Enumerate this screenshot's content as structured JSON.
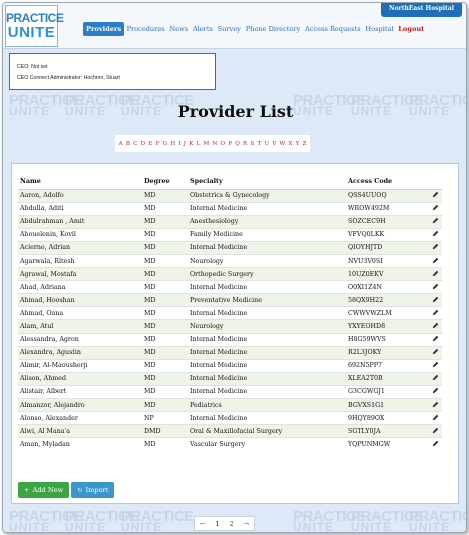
{
  "logo": {
    "line1": "PRACTICE",
    "line2": "UNITE"
  },
  "org_badge": "NorthEast Hospital",
  "nav": {
    "items": [
      "Providers",
      "Procedures",
      "News",
      "Alerts",
      "Survey",
      "Phone Directory",
      "Access Requests",
      "Hospital"
    ],
    "logout": "Logout",
    "active": "Providers"
  },
  "ceo": {
    "line1": "CEO: Not set",
    "line2": "CEO Connect Administrator: Hochron, Stuart"
  },
  "page_title": "Provider List",
  "alphabet": [
    "A",
    "B",
    "C",
    "D",
    "E",
    "F",
    "G",
    "H",
    "I",
    "J",
    "K",
    "L",
    "M",
    "N",
    "O",
    "P",
    "Q",
    "R",
    "S",
    "T",
    "U",
    "V",
    "W",
    "X",
    "Y",
    "Z"
  ],
  "table": {
    "headers": [
      "Name",
      "Degree",
      "Specialty",
      "Access Code"
    ],
    "rows": [
      [
        "Aaron, Adolfo",
        "MD",
        "Obstetrics & Gynecology",
        "QSS4UUOQ"
      ],
      [
        "Abdulla, Aditi",
        "MD",
        "Internal Medicine",
        "WROW492M"
      ],
      [
        "Abdulrahman , Amit",
        "MD",
        "Anesthesiology",
        "SOZCEC9H"
      ],
      [
        "Abouelenin, Kovil",
        "MD",
        "Family Medicine",
        "VFVQ0LKK"
      ],
      [
        "Acierno, Adrian",
        "MD",
        "Internal Medicine",
        "QIOYHJTD"
      ],
      [
        "Agarwala, Ritesh",
        "MD",
        "Neurology",
        "NVU3V0SI"
      ],
      [
        "Agrawal, Mostafa",
        "MD",
        "Orthopedic Surgery",
        "10UZ0EKV"
      ],
      [
        "Ahad, Adriana",
        "MD",
        "Internal Medicine",
        "O0XI1Z4N"
      ],
      [
        "Ahmad, Hooshan",
        "MD",
        "Preventative Medicine",
        "58QX9H22"
      ],
      [
        "Ahmad, Oana",
        "MD",
        "Internal Medicine",
        "CWWVWZLM"
      ],
      [
        "Alam, Atul",
        "MD",
        "Neurology",
        "YXYEOHD8"
      ],
      [
        "Alessandra, Agron",
        "MD",
        "Internal Medicine",
        "H8G59WVS"
      ],
      [
        "Alexandra, Agustin",
        "MD",
        "Internal Medicine",
        "R2L3JOKY"
      ],
      [
        "Alimir, Al-Maousherji",
        "MD",
        "Internal Medicine",
        "692N5PP7"
      ],
      [
        "Alison, Ahmed",
        "MD",
        "Internal Medicine",
        "XLEA2T0B"
      ],
      [
        "Alistair, Albert",
        "MD",
        "Internal Medicine",
        "G3CGWGJ1"
      ],
      [
        "Almanzor, Alejandro",
        "MD",
        "Pediatrics",
        "BGVXS1G1"
      ],
      [
        "Alonso, Alexander",
        "NP",
        "Internal Medicine",
        "9HQY89OX"
      ],
      [
        "Alwi, Al Mana'a",
        "DMD",
        "Oral & Maxillofacial Surgery",
        "SGTLY0JA"
      ],
      [
        "Aman, Myladan",
        "MD",
        "Vascular Surgery",
        "YQPUNMGW"
      ]
    ]
  },
  "buttons": {
    "add": "Add New",
    "import": "Import"
  },
  "pager": {
    "prev": "←",
    "pages": [
      "1",
      "2"
    ],
    "next": "→"
  },
  "colors": {
    "accent": "#2c7ec9",
    "add": "#3da444",
    "import": "#3b95cf",
    "logout": "#c21a1a",
    "row_alt": "#eef5e8"
  }
}
